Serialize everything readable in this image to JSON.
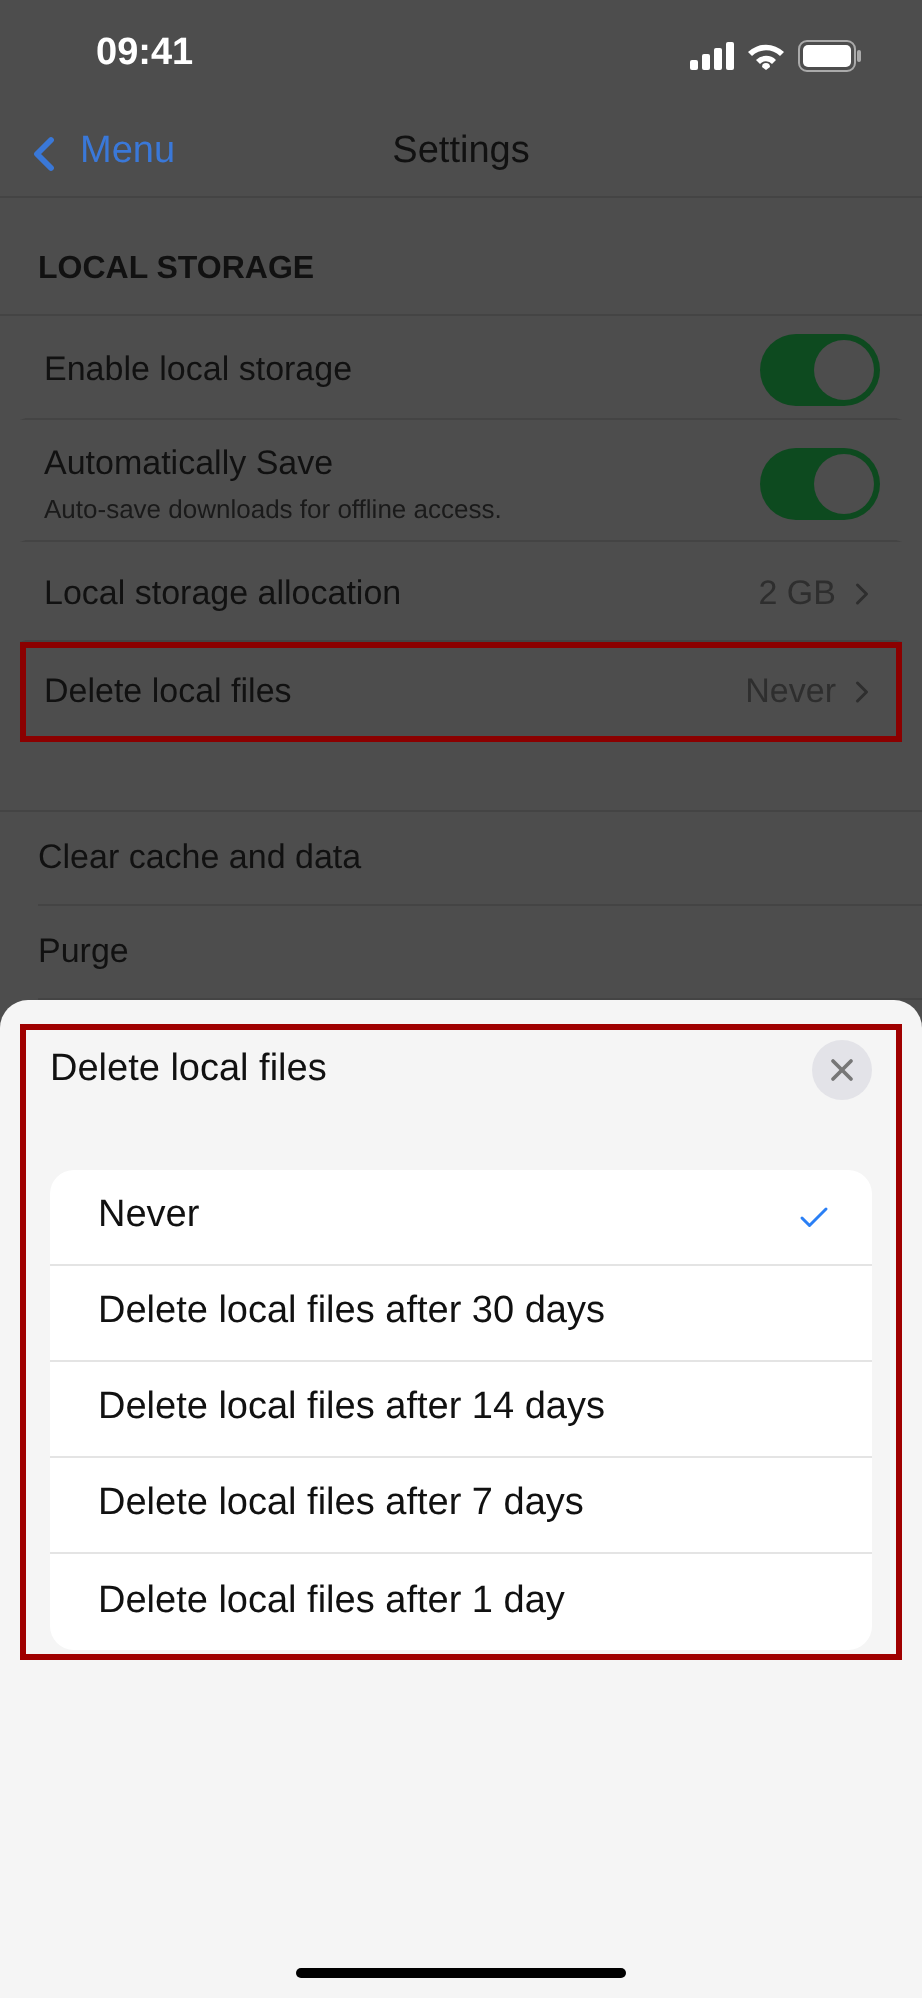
{
  "status_bar": {
    "time": "09:41"
  },
  "nav": {
    "back": "Menu",
    "title": "Settings"
  },
  "section": {
    "header": "LOCAL STORAGE",
    "rows": [
      {
        "kind": "toggle",
        "label": "Enable local storage",
        "on": true,
        "highlighted": false
      },
      {
        "kind": "toggle",
        "label": "Automatically Save",
        "subtitle": "Auto-save downloads for offline access.",
        "on": true,
        "highlighted": false
      },
      {
        "kind": "value",
        "label": "Local storage allocation",
        "value": "2 GB",
        "highlighted": false
      },
      {
        "kind": "value",
        "label": "Delete local files",
        "value": "Never",
        "highlighted": true
      }
    ]
  },
  "section_2": {
    "rows": [
      {
        "label": "Clear cache and data"
      },
      {
        "label": "Purge"
      }
    ]
  },
  "sheet": {
    "title": "Delete local files",
    "highlighted": true,
    "options": [
      {
        "label": "Never",
        "selected": true
      },
      {
        "label": "Delete local files after 30 days",
        "selected": false
      },
      {
        "label": "Delete local files after 14 days",
        "selected": false
      },
      {
        "label": "Delete local files after 7 days",
        "selected": false
      },
      {
        "label": "Delete local files after 1 day",
        "selected": false
      }
    ]
  }
}
